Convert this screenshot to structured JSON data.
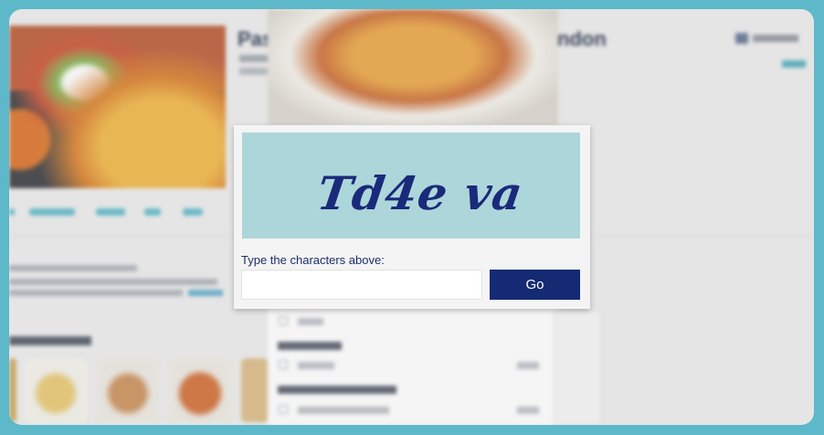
{
  "background_page": {
    "title_left": "Pas",
    "title_right": "ndon"
  },
  "captcha": {
    "characters": "Td4e va",
    "prompt": "Type the characters above:",
    "input_value": "",
    "input_placeholder": "",
    "submit_label": "Go"
  },
  "colors": {
    "frame": "#5db8c9",
    "captcha_bg": "#add6da",
    "captcha_text": "#1a2a7a",
    "button_bg": "#142a73",
    "prompt_text": "#1c2d6b"
  }
}
